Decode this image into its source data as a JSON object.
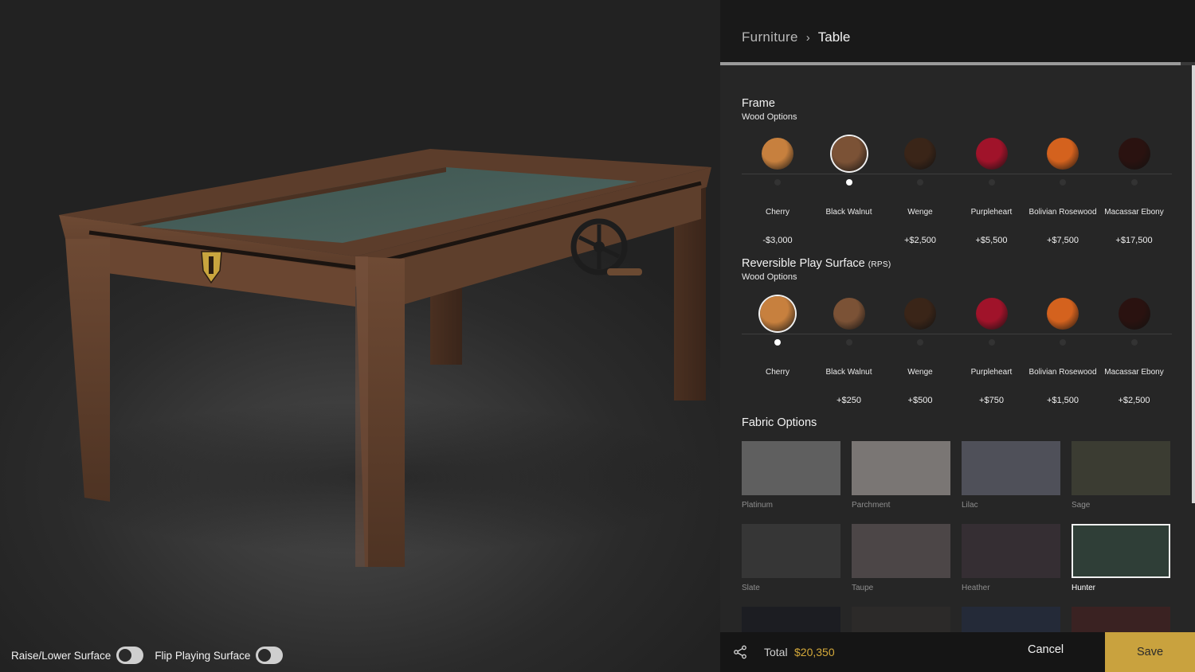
{
  "breadcrumb": {
    "parent": "Furniture",
    "separator": "›",
    "current": "Table"
  },
  "configuration_progress": 0.97,
  "frame": {
    "title": "Frame",
    "subtitle": "Wood Options",
    "selected": "Black Walnut",
    "options": [
      {
        "name": "Cherry",
        "price": "-$3,000",
        "color": "#c7803e"
      },
      {
        "name": "Black Walnut",
        "price": "",
        "color": "#7b5236"
      },
      {
        "name": "Wenge",
        "price": "+$2,500",
        "color": "#3a2518"
      },
      {
        "name": "Purpleheart",
        "price": "+$5,500",
        "color": "#a0132a"
      },
      {
        "name": "Bolivian Rosewood",
        "price": "+$7,500",
        "color": "#d4621e"
      },
      {
        "name": "Macassar Ebony",
        "price": "+$17,500",
        "color": "#2a1210"
      }
    ]
  },
  "rps": {
    "title": "Reversible Play Surface",
    "title_suffix": "(RPS)",
    "subtitle": "Wood Options",
    "selected": "Cherry",
    "options": [
      {
        "name": "Cherry",
        "price": "",
        "color": "#c7803e"
      },
      {
        "name": "Black Walnut",
        "price": "+$250",
        "color": "#7b5236"
      },
      {
        "name": "Wenge",
        "price": "+$500",
        "color": "#3a2518"
      },
      {
        "name": "Purpleheart",
        "price": "+$750",
        "color": "#a0132a"
      },
      {
        "name": "Bolivian Rosewood",
        "price": "+$1,500",
        "color": "#d4621e"
      },
      {
        "name": "Macassar Ebony",
        "price": "+$2,500",
        "color": "#2a1210"
      }
    ]
  },
  "fabric": {
    "title": "Fabric Options",
    "selected": "Hunter",
    "options": [
      {
        "name": "Platinum",
        "color": "#5f5f5f"
      },
      {
        "name": "Parchment",
        "color": "#7a7674"
      },
      {
        "name": "Lilac",
        "color": "#4f5059"
      },
      {
        "name": "Sage",
        "color": "#3b3c32"
      },
      {
        "name": "Slate",
        "color": "#363636"
      },
      {
        "name": "Taupe",
        "color": "#4c4647"
      },
      {
        "name": "Heather",
        "color": "#352e33"
      },
      {
        "name": "Hunter",
        "color": "#2f3e37"
      },
      {
        "name": "",
        "color": "#1c1d22"
      },
      {
        "name": "",
        "color": "#2c2a29"
      },
      {
        "name": "",
        "color": "#242a38"
      },
      {
        "name": "",
        "color": "#3a2222"
      }
    ]
  },
  "footer": {
    "total_label": "Total",
    "total_value": "$20,350",
    "cancel": "Cancel",
    "save": "Save",
    "share_icon": "share-icon"
  },
  "viewer": {
    "toggles": [
      {
        "label": "Raise/Lower Surface",
        "on": false
      },
      {
        "label": "Flip Playing Surface",
        "on": false
      }
    ]
  },
  "colors": {
    "accent": "#c9a23e",
    "selected_ring": "#f0f0f0"
  }
}
